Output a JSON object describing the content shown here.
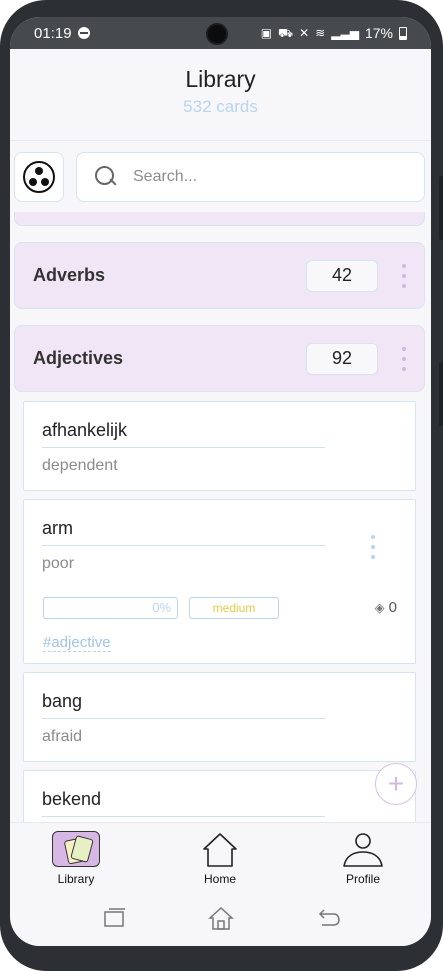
{
  "status_bar": {
    "time": "01:19",
    "battery_pct": "17%"
  },
  "header": {
    "title": "Library",
    "card_count": "532 cards"
  },
  "search": {
    "placeholder": "Search..."
  },
  "groups": [
    {
      "name": "Adverbs",
      "count": "42"
    },
    {
      "name": "Adjectives",
      "count": "92"
    }
  ],
  "cards": [
    {
      "word": "afhankelijk",
      "translation": "dependent"
    },
    {
      "word": "arm",
      "translation": "poor",
      "progress": "0%",
      "progress_value": 0,
      "difficulty": "medium",
      "views": "0",
      "tag": "#adjective"
    },
    {
      "word": "bang",
      "translation": "afraid"
    },
    {
      "word": "bekend",
      "translation": ""
    }
  ],
  "fab": {
    "icon": "plus-icon"
  },
  "bottom_nav": [
    {
      "label": "Library",
      "icon": "library-cards-icon",
      "active": true
    },
    {
      "label": "Home",
      "icon": "home-icon",
      "active": false
    },
    {
      "label": "Profile",
      "icon": "profile-icon",
      "active": false
    }
  ],
  "colors": {
    "accent_purple": "#f0e6f6",
    "accent_blue": "#b9d4f0",
    "difficulty_medium": "#e5c84a"
  }
}
